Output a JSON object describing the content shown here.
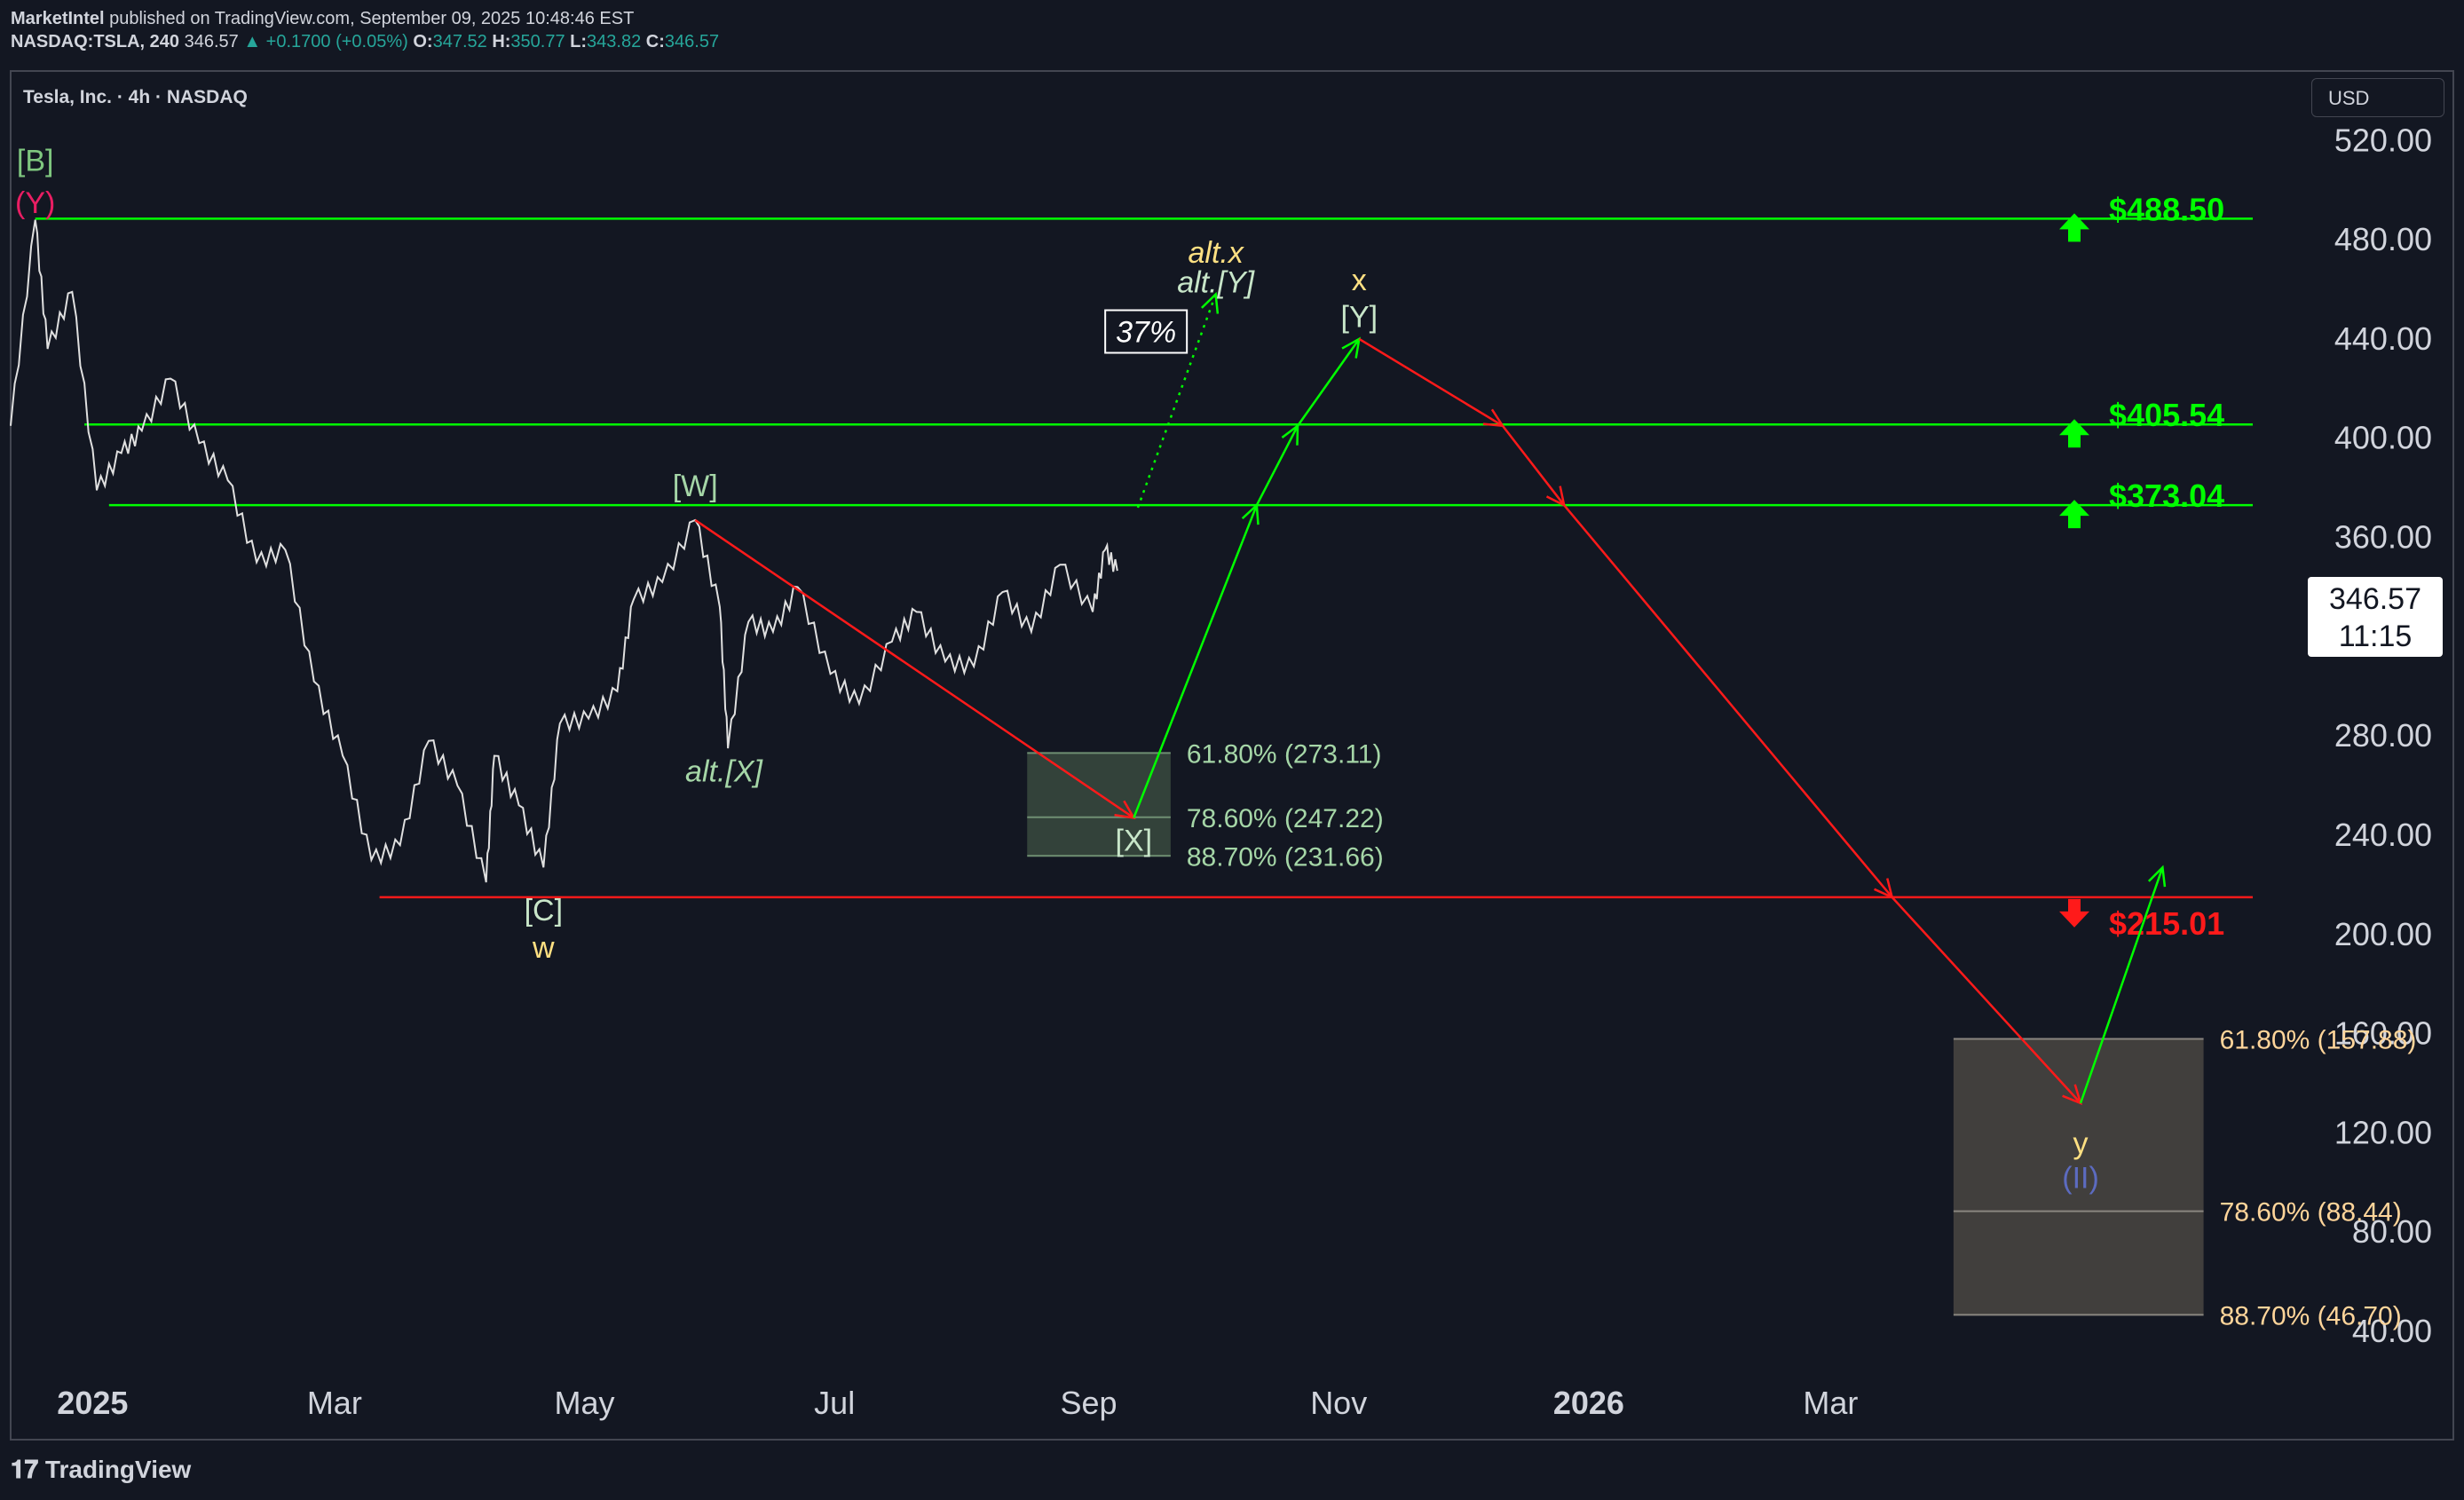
{
  "header": {
    "publisher": "MarketIntel",
    "published_text": "published on TradingView.com, September 09, 2025 10:48:46 EST",
    "symbol": "NASDAQ:TSLA, 240",
    "last": "346.57",
    "change": "▲ +0.1700 (+0.05%)",
    "o_label": "O:",
    "o_val": "347.52",
    "h_label": "H:",
    "h_val": "350.77",
    "l_label": "L:",
    "l_val": "343.82",
    "c_label": "C:",
    "c_val": "346.57"
  },
  "chart_title": "Tesla, Inc. · 4h · NASDAQ",
  "currency_button": "USD",
  "price_tag": {
    "price": "346.57",
    "countdown": "11:15"
  },
  "footer": {
    "logo_text": "TradingView"
  },
  "colors": {
    "background": "#131722",
    "green": "#00ff00",
    "red": "#ff1a1a",
    "candles": "#e0e0e0",
    "zone_green": "#3a4a3e",
    "zone_brown": "#4a4642"
  },
  "chart_data": {
    "type": "line",
    "ylim": [
      30,
      548
    ],
    "x_range": [
      "2024-12-12",
      "2026-06-12"
    ],
    "y_ticks": [
      "520.00",
      "480.00",
      "440.00",
      "400.00",
      "360.00",
      "320.00",
      "280.00",
      "240.00",
      "200.00",
      "160.00",
      "120.00",
      "80.00",
      "40.00"
    ],
    "x_ticks": [
      {
        "date": "2025-01-01",
        "label": "2025",
        "bold": true
      },
      {
        "date": "2025-03-01",
        "label": "Mar"
      },
      {
        "date": "2025-05-01",
        "label": "May"
      },
      {
        "date": "2025-07-01",
        "label": "Jul"
      },
      {
        "date": "2025-09-01",
        "label": "Sep"
      },
      {
        "date": "2025-11-01",
        "label": "Nov"
      },
      {
        "date": "2026-01-01",
        "label": "2026",
        "bold": true
      },
      {
        "date": "2026-03-01",
        "label": "Mar"
      }
    ],
    "price_series": [
      [
        "2024-12-12",
        405
      ],
      [
        "2024-12-18",
        488
      ],
      [
        "2024-12-21",
        436
      ],
      [
        "2024-12-27",
        459
      ],
      [
        "2025-01-02",
        379
      ],
      [
        "2025-01-08",
        394
      ],
      [
        "2025-01-13",
        403
      ],
      [
        "2025-01-20",
        424
      ],
      [
        "2025-01-27",
        398
      ],
      [
        "2025-02-03",
        383
      ],
      [
        "2025-02-10",
        350
      ],
      [
        "2025-02-17",
        355
      ],
      [
        "2025-02-24",
        302
      ],
      [
        "2025-03-03",
        272
      ],
      [
        "2025-03-10",
        230
      ],
      [
        "2025-03-17",
        236
      ],
      [
        "2025-03-24",
        278
      ],
      [
        "2025-03-31",
        260
      ],
      [
        "2025-04-07",
        221
      ],
      [
        "2025-04-09",
        272
      ],
      [
        "2025-04-15",
        252
      ],
      [
        "2025-04-21",
        227
      ],
      [
        "2025-04-25",
        285
      ],
      [
        "2025-05-02",
        287
      ],
      [
        "2025-05-09",
        298
      ],
      [
        "2025-05-13",
        335
      ],
      [
        "2025-05-20",
        342
      ],
      [
        "2025-05-28",
        367
      ],
      [
        "2025-06-03",
        332
      ],
      [
        "2025-06-05",
        275
      ],
      [
        "2025-06-10",
        326
      ],
      [
        "2025-06-16",
        322
      ],
      [
        "2025-06-22",
        340
      ],
      [
        "2025-06-30",
        305
      ],
      [
        "2025-07-07",
        293
      ],
      [
        "2025-07-15",
        318
      ],
      [
        "2025-07-21",
        330
      ],
      [
        "2025-07-28",
        310
      ],
      [
        "2025-08-04",
        308
      ],
      [
        "2025-08-11",
        338
      ],
      [
        "2025-08-18",
        322
      ],
      [
        "2025-08-25",
        349
      ],
      [
        "2025-09-02",
        330
      ],
      [
        "2025-09-05",
        355
      ],
      [
        "2025-09-08",
        346.57
      ]
    ],
    "levels": [
      {
        "value": 488.5,
        "label": "$488.50",
        "color": "green",
        "start": "2024-12-18"
      },
      {
        "value": 405.54,
        "label": "$405.54",
        "color": "green",
        "start": "2024-12-30"
      },
      {
        "value": 373.04,
        "label": "$373.04",
        "color": "green",
        "start": "2025-01-05"
      },
      {
        "value": 215.01,
        "label": "$215.01",
        "color": "red",
        "start": "2025-03-12"
      }
    ],
    "fib_zones": [
      {
        "start": "2025-08-17",
        "end": "2025-09-21",
        "top": 273.11,
        "bottom": 231.66,
        "mid": 247.22,
        "color": "green",
        "labels": [
          "61.80% (273.11)",
          "78.60% (247.22)",
          "88.70% (231.66)"
        ]
      },
      {
        "start": "2026-03-31",
        "end": "2026-05-31",
        "top": 157.88,
        "bottom": 46.7,
        "mid": 88.44,
        "color": "brown",
        "labels": [
          "61.80% (157.88)",
          "78.60% (88.44)",
          "88.70% (46.70)"
        ]
      }
    ],
    "projection_paths": [
      {
        "color": "red",
        "points": [
          [
            "2025-05-28",
            367
          ],
          [
            "2025-09-12",
            247
          ]
        ]
      },
      {
        "color": "green",
        "points": [
          [
            "2025-09-12",
            247
          ],
          [
            "2025-10-12",
            373
          ],
          [
            "2025-10-22",
            405
          ],
          [
            "2025-11-06",
            440
          ]
        ]
      },
      {
        "color": "red",
        "points": [
          [
            "2025-11-06",
            440
          ],
          [
            "2025-12-11",
            405
          ],
          [
            "2025-12-26",
            373
          ],
          [
            "2026-03-16",
            215
          ],
          [
            "2026-05-01",
            132
          ]
        ]
      },
      {
        "color": "green",
        "points": [
          [
            "2026-05-01",
            132
          ],
          [
            "2026-05-21",
            227
          ]
        ]
      }
    ],
    "dotted_path": {
      "color": "green",
      "points": [
        [
          "2025-09-13",
          372
        ],
        [
          "2025-10-02",
          458
        ]
      ]
    },
    "annotations": [
      {
        "text": "[B]",
        "date": "2024-12-18",
        "value": 512,
        "color": "#7fc77f"
      },
      {
        "text": "(Y)",
        "date": "2024-12-18",
        "value": 495,
        "color": "#e91e63"
      },
      {
        "text": "[W]",
        "date": "2025-05-28",
        "value": 381,
        "color": "#a5d6a7"
      },
      {
        "text": "alt.[X]",
        "date": "2025-06-04",
        "value": 266,
        "color": "#a5d6a7",
        "italic": true
      },
      {
        "text": "[C]",
        "date": "2025-04-21",
        "value": 210,
        "color": "#c8e6c9"
      },
      {
        "text": "w",
        "date": "2025-04-21",
        "value": 195,
        "color": "#ffe082"
      },
      {
        "text": "[X]",
        "date": "2025-09-12",
        "value": 238,
        "color": "#c8e6c9"
      },
      {
        "text": "alt.x",
        "date": "2025-10-02",
        "value": 475,
        "color": "#ffe082",
        "italic": true
      },
      {
        "text": "alt.[Y]",
        "date": "2025-10-02",
        "value": 463,
        "color": "#c8e6c9",
        "italic": true
      },
      {
        "text": "37%",
        "date": "2025-09-15",
        "value": 443,
        "color": "#ffffff",
        "boxed": true,
        "italic": true
      },
      {
        "text": "x",
        "date": "2025-11-06",
        "value": 464,
        "color": "#ffe082"
      },
      {
        "text": "[Y]",
        "date": "2025-11-06",
        "value": 449,
        "color": "#c8e6c9"
      },
      {
        "text": "y",
        "date": "2026-05-01",
        "value": 116,
        "color": "#ffe082"
      },
      {
        "text": "(II)",
        "date": "2026-05-01",
        "value": 102,
        "color": "#5c6bc0"
      }
    ]
  }
}
